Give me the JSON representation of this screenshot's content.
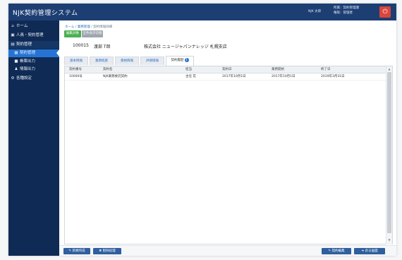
{
  "app": {
    "title": "NJK契約管理システム"
  },
  "topbar": {
    "user": "NJK 太郎",
    "meta_line1": "所属：契約管理課",
    "meta_line2": "権限：管理者",
    "logout_icon": "⏻"
  },
  "sidebar": {
    "items": [
      {
        "icon": "home-icon",
        "glyph": "⌂",
        "label": "ホーム"
      },
      {
        "icon": "users-icon",
        "glyph": "▣",
        "label": "人員・契約管理"
      },
      {
        "icon": "contract-icon",
        "glyph": "▤",
        "label": "契約管理"
      },
      {
        "icon": "list-icon",
        "glyph": "▦",
        "label": "契約管理"
      },
      {
        "icon": "doc-icon",
        "glyph": "■",
        "label": "帳票出力"
      },
      {
        "icon": "person-icon",
        "glyph": "♟",
        "label": "情報出力"
      },
      {
        "icon": "gear-icon",
        "glyph": "⚙",
        "label": "各種設定"
      }
    ]
  },
  "breadcrumb": {
    "home": "ホーム",
    "sep": " / ",
    "section": "業務管理",
    "current": "契約情報詳細"
  },
  "actions": {
    "green_label": "編集対象",
    "gray_label": "全件表示切替"
  },
  "record": {
    "id": "100015",
    "name": "渡部 T郎",
    "company": "株式会社 ニュージャパンナレッジ 札幌支店"
  },
  "tabs": [
    {
      "label": "基本情報"
    },
    {
      "label": "業務経歴"
    },
    {
      "label": "資格情報"
    },
    {
      "label": "評価情報"
    },
    {
      "label": "契約履歴",
      "badge": "1"
    }
  ],
  "table": {
    "headers": [
      "契約番号",
      "契約名",
      "担当",
      "契約日",
      "業務開始",
      "終了日"
    ],
    "rows": [
      [
        "10000号",
        "NJK業務委託契約",
        "主任 花",
        "2017年10月1日",
        "2017年10月1日",
        "2019年3月31日"
      ]
    ]
  },
  "footer": {
    "btn1": "✎ 新規作成",
    "btn2": "✖ 削除処理",
    "btn3": "✎ 契約編集",
    "btn4": "➜ 戻る画面"
  }
}
